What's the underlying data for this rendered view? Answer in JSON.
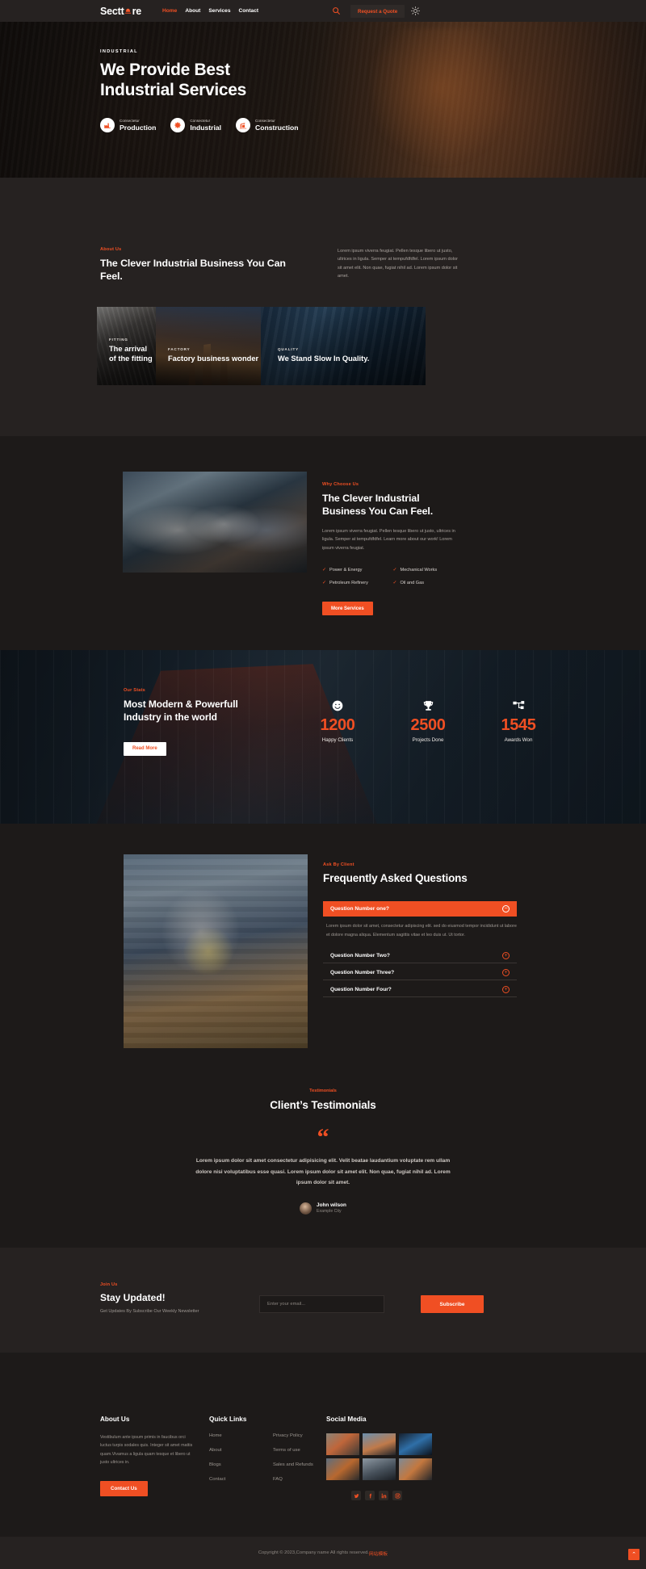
{
  "header": {
    "logo_text_1": "Sectt",
    "logo_text_2": "re",
    "nav": [
      {
        "label": "Home",
        "active": true
      },
      {
        "label": "About",
        "active": false
      },
      {
        "label": "Services",
        "active": false
      },
      {
        "label": "Contact",
        "active": false
      }
    ],
    "search_icon": "search-icon",
    "quote_label": "Request a Quote",
    "theme_icon": "sun-icon"
  },
  "hero": {
    "eyebrow": "INDUSTRIAL",
    "title_line1": "We Provide Best",
    "title_line2": "Industrial Services",
    "badges": [
      {
        "sub": "Consectetur",
        "title": "Production",
        "icon": "factory-icon"
      },
      {
        "sub": "Consectetur",
        "title": "Industrial",
        "icon": "gear-icon"
      },
      {
        "sub": "Consectetur",
        "title": "Construction",
        "icon": "crane-icon"
      }
    ]
  },
  "about": {
    "eyebrow": "About Us",
    "title": "The Clever Industrial Business You Can Feel.",
    "paragraph": "Lorem ipsum viverra feugiat. Pellen tesque libero ut justo, ultrices in ligula. Semper at tempufdfdfel. Lorem ipsum dolor sit amet elit. Non quae, fugiat nihil ad. Lorem ipsum dolor sit amet.",
    "cards": [
      {
        "tag": "FITTING",
        "title": "The arrival of the fitting"
      },
      {
        "tag": "FACTORY",
        "title": "Factory business wonder"
      },
      {
        "tag": "QUALITY",
        "title": "We Stand Slow In Quality."
      }
    ]
  },
  "why": {
    "eyebrow": "Why Choose Us",
    "title": "The Clever Industrial Business You Can Feel.",
    "paragraph": "Lorem ipsum viverra feugiat. Pellen tesque libero ut justo, ultrices in ligula. Semper at tempufdfdfel. Learn more about our work! Lorem ipsum viverra feugiat.",
    "features": [
      "Power & Energy",
      "Mechanical Works",
      "Petroleum Refinery",
      "Oil and Gas"
    ],
    "button": "More Services",
    "image_name": "team-meeting-photo"
  },
  "stats": {
    "eyebrow": "Our Stats",
    "title": "Most Modern & Powerfull Industry in the world",
    "button": "Read More",
    "counters": [
      {
        "icon": "smiley-icon",
        "value": "1200",
        "label": "Happy Clients"
      },
      {
        "icon": "trophy-icon",
        "value": "2500",
        "label": "Projects Done"
      },
      {
        "icon": "network-icon",
        "value": "1545",
        "label": "Awards Won"
      }
    ]
  },
  "faq": {
    "eyebrow": "Ask By Client",
    "title": "Frequently Asked Questions",
    "image_name": "worker-with-helmet-photo",
    "items": [
      {
        "question": "Question Number one?",
        "open": true,
        "sign": "−",
        "answer": "Lorem ipsum dolor sit amet, consectetur adipiscing elit. sed do eiusmod tempor incididunt ut labore et dolore magna aliqua. Elementum sagittis vitae et leo duis ut. Ut tortor."
      },
      {
        "question": "Question Number Two?",
        "open": false,
        "sign": "+",
        "answer": ""
      },
      {
        "question": "Question Number Three?",
        "open": false,
        "sign": "+",
        "answer": ""
      },
      {
        "question": "Question Number Four?",
        "open": false,
        "sign": "+",
        "answer": ""
      }
    ]
  },
  "testimonials": {
    "eyebrow": "Testimonials",
    "title": "Client’s Testimonials",
    "quote_icon": "quote-mark-icon",
    "text": "Lorem ipsum dolor sit amet consectetur adipisicing elit. Velit beatae laudantium voluptate rem ullam dolore nisi voluptatibus esse quasi. Lorem ipsum dolor sit amet elit. Non quae, fugiat nihil ad. Lorem ipsum dolor sit amet.",
    "author_name": "John wilson",
    "author_role": "Example City"
  },
  "newsletter": {
    "eyebrow": "Join Us",
    "title": "Stay Updated!",
    "paragraph": "Get Updates By Subscribe Our Weekly Newsletter",
    "input_placeholder": "Enter your email...",
    "button": "Subscribe"
  },
  "footer": {
    "about_title": "About Us",
    "about_text": "Vestibulum ante ipsum primis in faucibus orci luctus turpis sodales quis. Integer sit amet mattis quam.Vivamus a ligula quam tesque et libero ut justo ultrices in.",
    "contact_button": "Contact Us",
    "quick_title": "Quick Links",
    "quick_col1": [
      "Home",
      "About",
      "Blogs",
      "Contact"
    ],
    "quick_col2": [
      "Privacy Policy",
      "Terms of use",
      "Sales and Refunds",
      "FAQ"
    ],
    "social_title": "Social Media",
    "thumbnails": [
      "thumb-workers",
      "thumb-refinery",
      "thumb-night-plant",
      "thumb-welder",
      "thumb-meeting",
      "thumb-machinery"
    ],
    "social_icons": [
      "twitter-icon",
      "facebook-icon",
      "linkedin-icon",
      "instagram-icon"
    ]
  },
  "copyright": {
    "text": "Copyright © 2023,Company name All rights reserved.",
    "highlight": "网站模板",
    "scroll_top_icon": "arrow-up-icon"
  },
  "colors": {
    "accent": "#f04f23",
    "page_bg": "#1d1a19",
    "panel_bg": "#262221",
    "text": "#e9e5e2",
    "muted": "#9b958f"
  }
}
